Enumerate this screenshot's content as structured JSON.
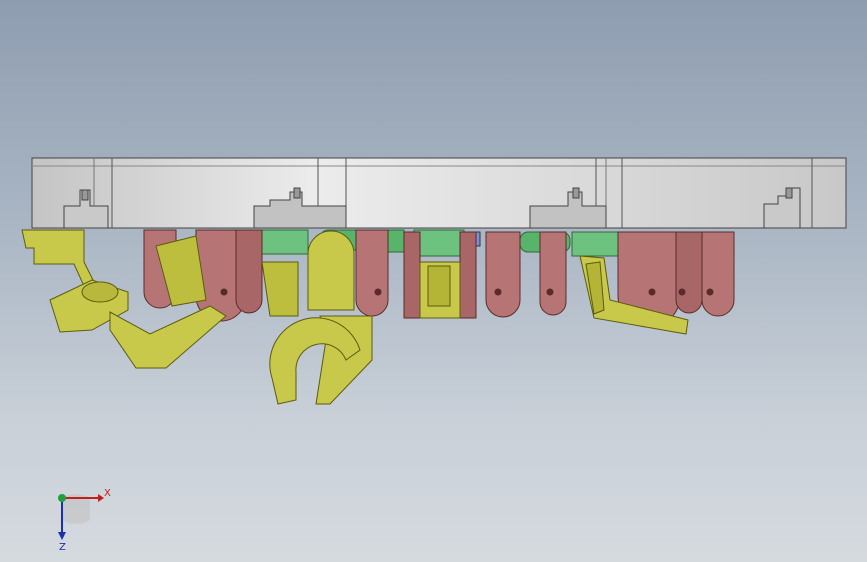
{
  "viewport": {
    "background_top": "#8e9db0",
    "background_bottom": "#d5dadf"
  },
  "colors": {
    "plate": "#d7d7d7",
    "plate_shade": "#b9b9b9",
    "plate_edge": "#4a4a4a",
    "link": "#b67474",
    "link_dark": "#8f5050",
    "pin": "#6ec27f",
    "pin_dark": "#3f9a55",
    "gripper": "#c8c84a",
    "gripper_dark": "#8f8f22",
    "axis_x": "#c0201c",
    "axis_y": "#1ea03a",
    "axis_z": "#1b2fb0"
  },
  "triad": {
    "x_label": "X",
    "z_label": "Z"
  }
}
